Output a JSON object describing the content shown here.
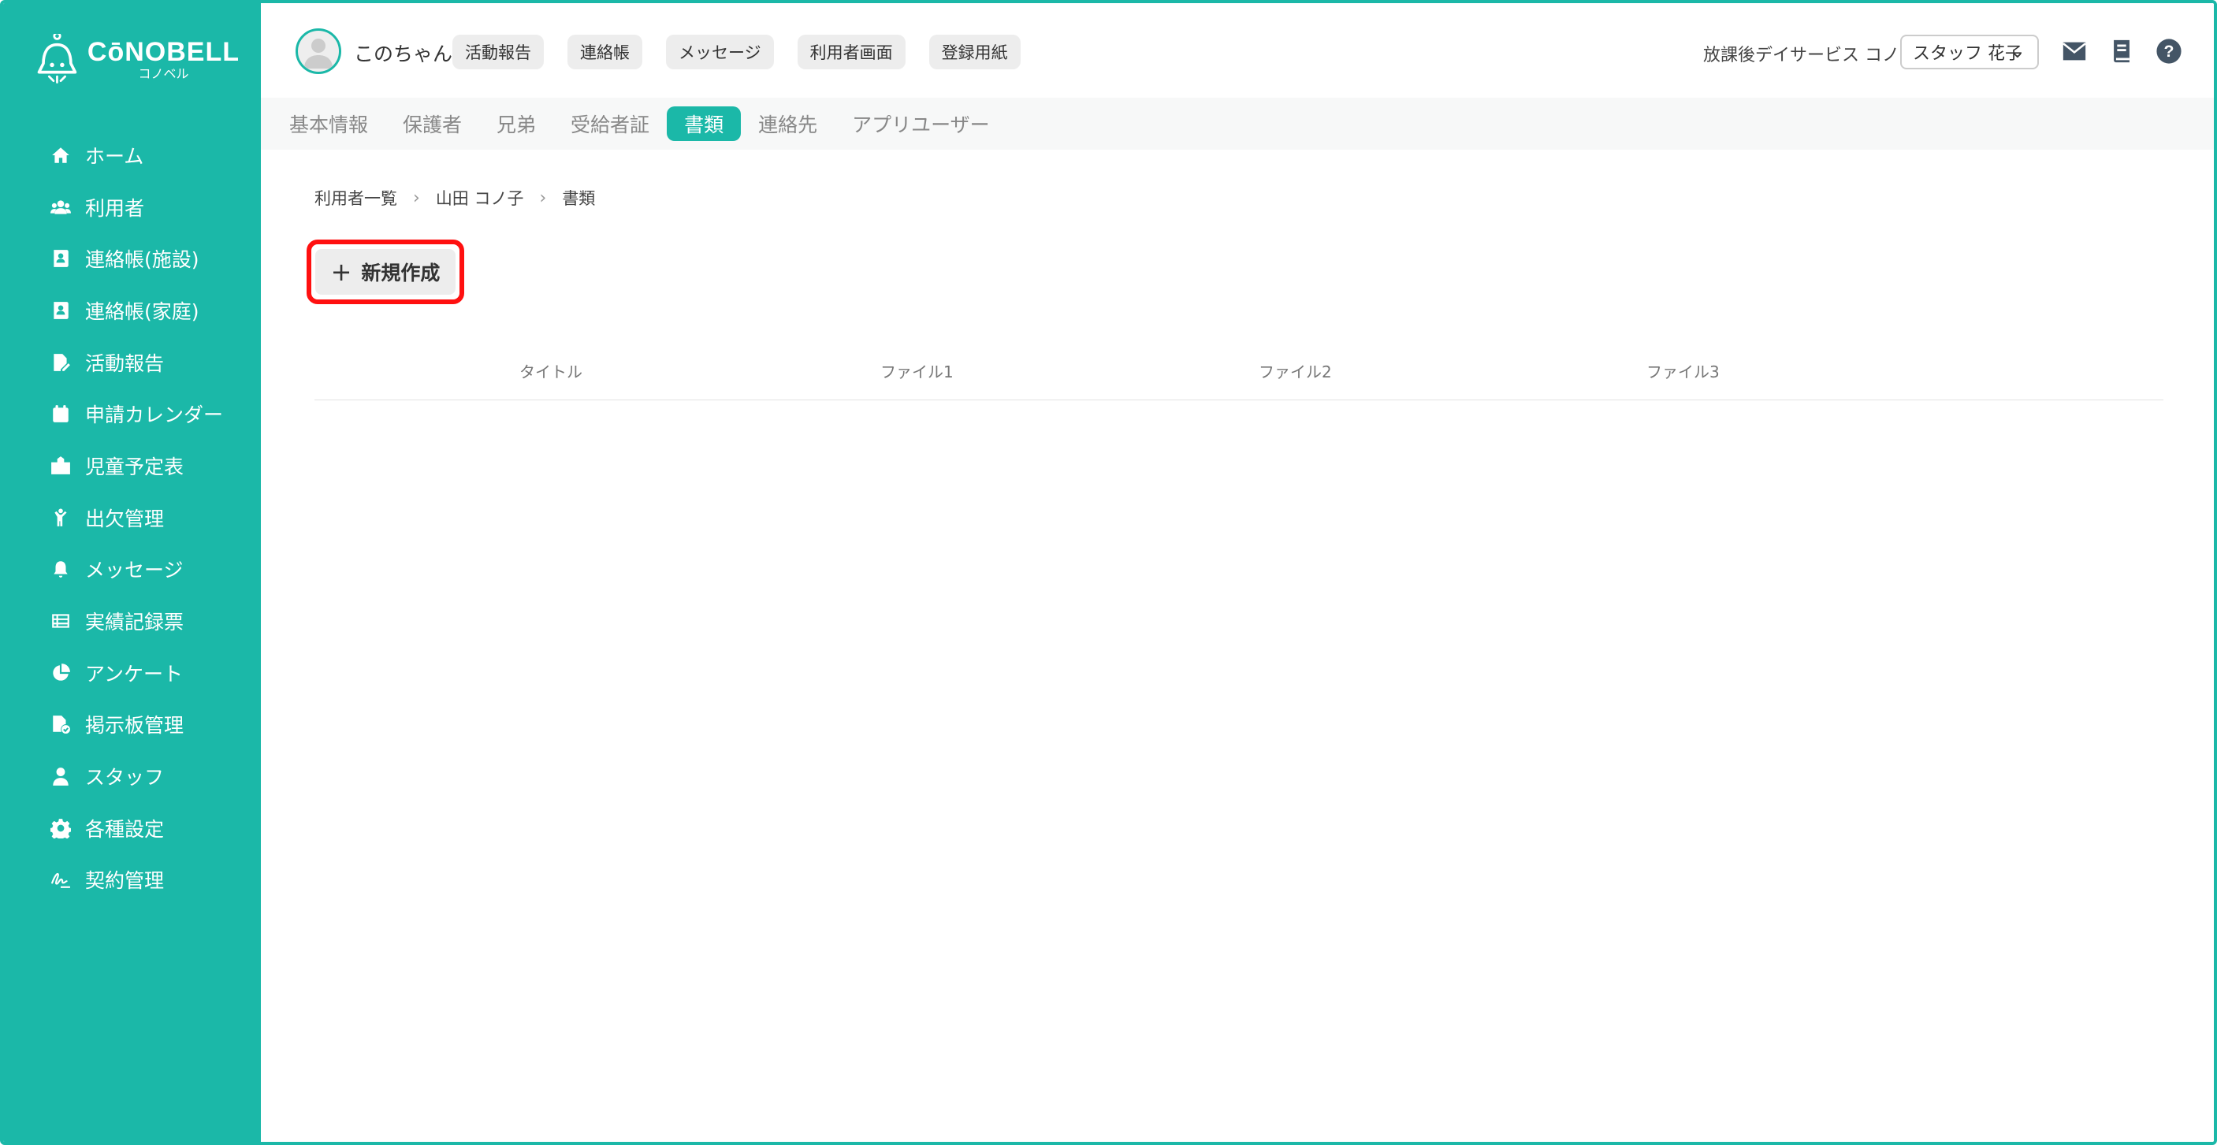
{
  "brand": {
    "name": "CōNOBELL",
    "sub": "コノベル"
  },
  "sidebar": {
    "items": [
      {
        "label": "ホーム",
        "icon": "home-icon"
      },
      {
        "label": "利用者",
        "icon": "users-icon"
      },
      {
        "label": "連絡帳(施設)",
        "icon": "contact-book-icon"
      },
      {
        "label": "連絡帳(家庭)",
        "icon": "contact-book-icon"
      },
      {
        "label": "活動報告",
        "icon": "report-edit-icon"
      },
      {
        "label": "申請カレンダー",
        "icon": "calendar-icon"
      },
      {
        "label": "児童予定表",
        "icon": "school-icon"
      },
      {
        "label": "出欠管理",
        "icon": "child-icon"
      },
      {
        "label": "メッセージ",
        "icon": "bell-icon"
      },
      {
        "label": "実績記録票",
        "icon": "table-icon"
      },
      {
        "label": "アンケート",
        "icon": "pie-chart-icon"
      },
      {
        "label": "掲示板管理",
        "icon": "file-check-icon"
      },
      {
        "label": "スタッフ",
        "icon": "staff-icon"
      },
      {
        "label": "各種設定",
        "icon": "gear-icon"
      },
      {
        "label": "契約管理",
        "icon": "signature-icon"
      }
    ]
  },
  "header": {
    "user_name": "このちゃん",
    "chips": [
      "活動報告",
      "連絡帳",
      "メッセージ",
      "利用者画面",
      "登録用紙"
    ],
    "facility": "放課後デイサービス コノベル",
    "staff_selected": "スタッフ 花子"
  },
  "tabs": [
    {
      "label": "基本情報",
      "active": false
    },
    {
      "label": "保護者",
      "active": false
    },
    {
      "label": "兄弟",
      "active": false
    },
    {
      "label": "受給者証",
      "active": false
    },
    {
      "label": "書類",
      "active": true
    },
    {
      "label": "連絡先",
      "active": false
    },
    {
      "label": "アプリユーザー",
      "active": false
    }
  ],
  "breadcrumb": [
    "利用者一覧",
    "山田 コノ子",
    "書類"
  ],
  "new_button": {
    "label": "新規作成"
  },
  "table": {
    "columns": [
      "タイトル",
      "ファイル1",
      "ファイル2",
      "ファイル3"
    ]
  },
  "colors": {
    "accent": "#1bb8a8",
    "highlight": "#ff1010"
  }
}
